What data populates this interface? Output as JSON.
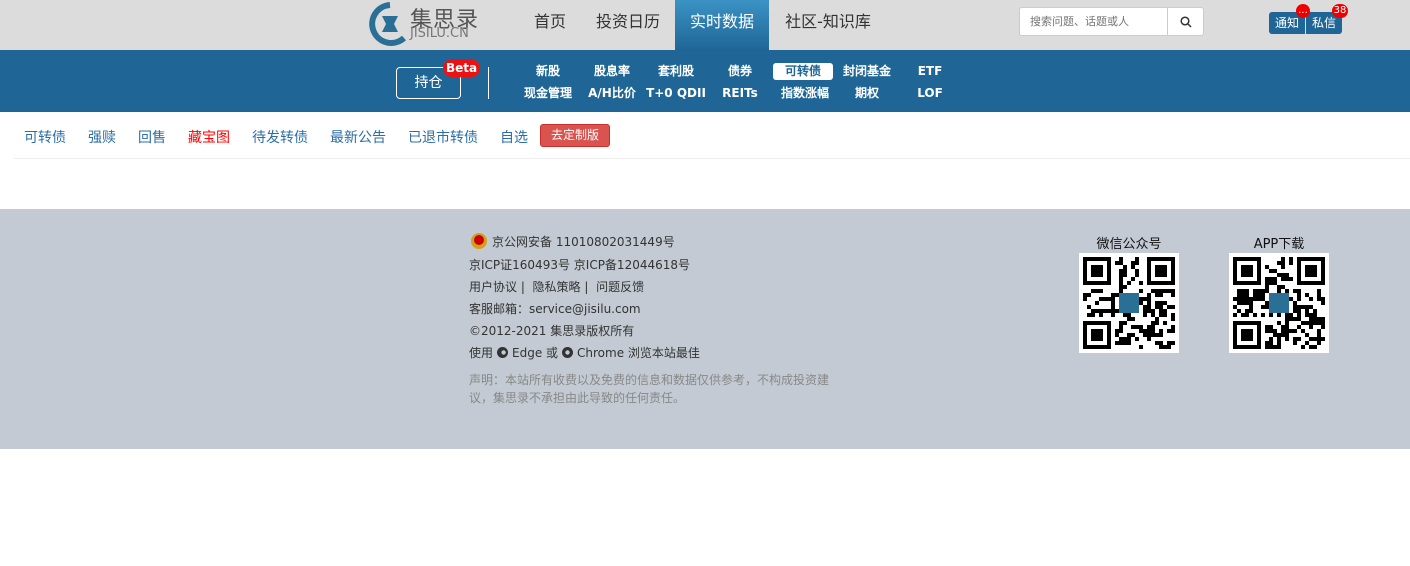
{
  "header": {
    "logo_text": "集思录",
    "logo_sub": "JISILU.CN",
    "nav": [
      {
        "label": "首页"
      },
      {
        "label": "投资日历"
      },
      {
        "label": "实时数据",
        "active": true
      },
      {
        "label": "社区-知识库"
      }
    ],
    "search_placeholder": "搜索问题、话题或人",
    "notify_label": "通知",
    "notify_badge": "...",
    "message_label": "私信",
    "message_badge": "38"
  },
  "toolbar": {
    "holdings_label": "持仓",
    "beta": "Beta",
    "categories": [
      [
        "新股",
        "股息率",
        "套利股",
        "债券",
        "可转债",
        "封闭基金",
        "ETF"
      ],
      [
        "现金管理",
        "A/H比价",
        "T+0 QDII",
        "REITs",
        "指数涨幅",
        "期权",
        "LOF"
      ]
    ],
    "selected": "可转债"
  },
  "subnav": {
    "items": [
      "可转债",
      "强赎",
      "回售",
      "藏宝图",
      "待发转债",
      "最新公告",
      "已退市转债",
      "自选"
    ],
    "custom_label": "去定制版",
    "highlight_color": "#ff0000"
  },
  "footer": {
    "police": "京公网安备 11010802031449号",
    "icp": "京ICP证160493号 京ICP备12044618号",
    "links": [
      "用户协议",
      "隐私策略",
      "问题反馈"
    ],
    "sep": "|",
    "email": "客服邮箱：service@jisilu.com",
    "copyright": "©2012-2021 集思录版权所有",
    "browser_pre": "使用",
    "browser_edge": "Edge 或",
    "browser_chrome": "Chrome 浏览本站最佳",
    "disclaimer": "声明：本站所有收费以及免费的信息和数据仅供参考，不构成投资建议，集思录不承担由此导致的任何责任。",
    "wechat_label": "微信公众号",
    "app_label": "APP下载"
  }
}
